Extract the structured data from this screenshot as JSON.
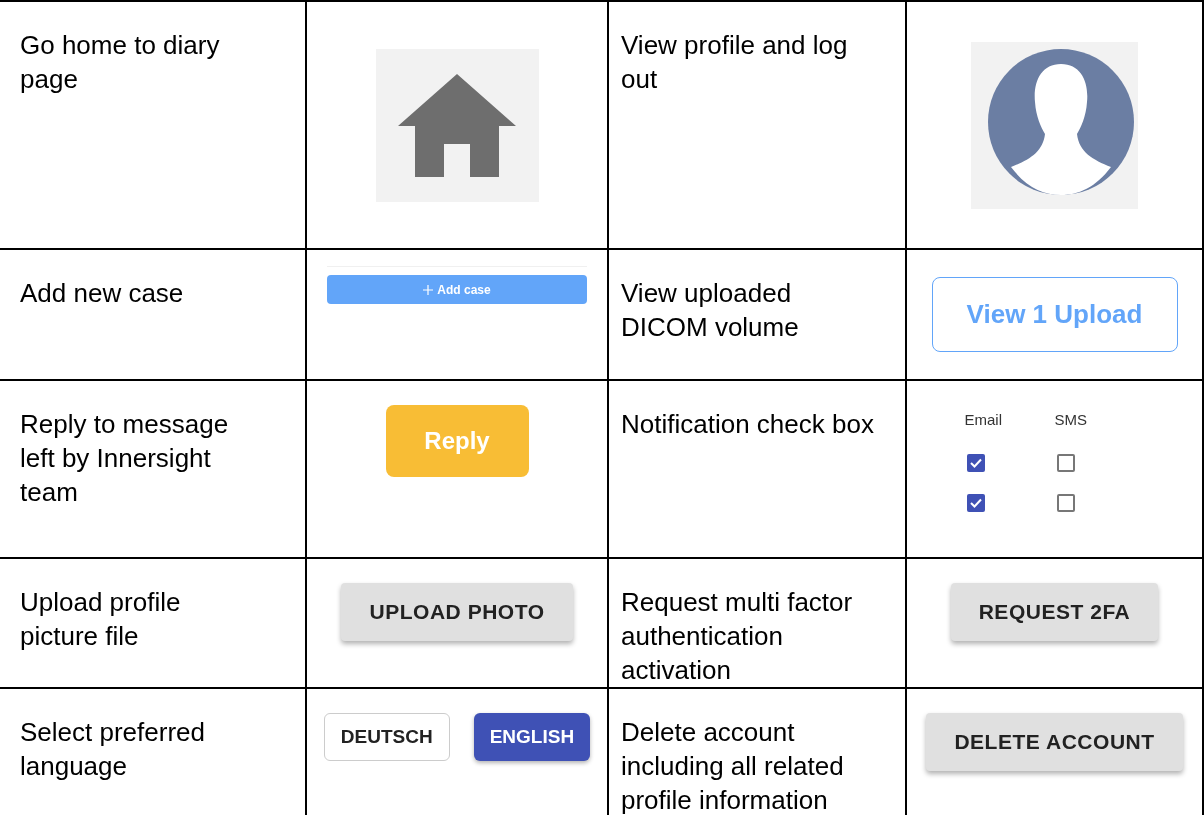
{
  "table": {
    "rows": [
      {
        "description_1": "Go home to diary page",
        "widget_1": {
          "kind": "home"
        },
        "description_2": "View profile and log out",
        "widget_2": {
          "kind": "avatar"
        }
      },
      {
        "description_1": "Add new case",
        "widget_1": {
          "kind": "add",
          "label": "Add case"
        },
        "description_2": "View uploaded DICOM volume",
        "widget_2": {
          "kind": "outline",
          "label": "View 1 Upload"
        }
      },
      {
        "description_1": "Reply to message left by Innersight team",
        "widget_1": {
          "kind": "reply",
          "label": "Reply"
        },
        "description_2": "Notification check box",
        "widget_2": {
          "kind": "checkboxes",
          "headers": [
            "Email",
            "SMS"
          ],
          "rows": [
            [
              {
                "checked": true
              },
              {
                "checked": false
              }
            ],
            [
              {
                "checked": true
              },
              {
                "checked": false
              }
            ]
          ]
        }
      },
      {
        "description_1": "Upload profile picture file",
        "widget_1": {
          "kind": "raised",
          "label": "UPLOAD PHOTO"
        },
        "description_2": "Request multi factor authentication activation",
        "widget_2": {
          "kind": "raised",
          "label": "REQUEST 2FA"
        }
      },
      {
        "description_1": "Select preferred language",
        "widget_1": {
          "kind": "language",
          "options": [
            {
              "label": "DEUTSCH",
              "selected": false
            },
            {
              "label": "ENGLISH",
              "selected": true
            }
          ]
        },
        "description_2": "Delete account including all related profile information",
        "widget_2": {
          "kind": "raised",
          "label": "DELETE ACCOUNT"
        }
      }
    ]
  }
}
